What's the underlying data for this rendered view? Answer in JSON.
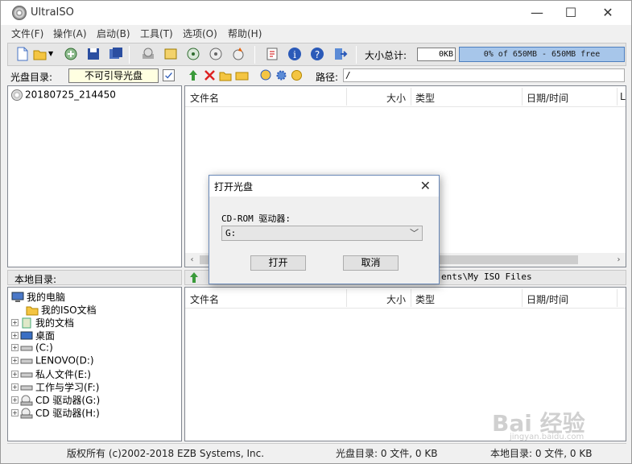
{
  "window": {
    "title": "UltraISO",
    "minimize": "—",
    "maximize": "☐",
    "close": "✕"
  },
  "menu": [
    "文件(F)",
    "操作(A)",
    "启动(B)",
    "工具(T)",
    "选项(O)",
    "帮助(H)"
  ],
  "toolbar": {
    "size_label": "大小总计:",
    "size_value": "0KB",
    "capacity_text": "0% of 650MB - 650MB free",
    "capacity_color": "#a7c6ea"
  },
  "iso_panel": {
    "label": "光盘目录:",
    "boot_status": "不可引导光盘",
    "path_label": "路径:",
    "path_value": "/",
    "tree_item": "20180725_214450",
    "columns": [
      "文件名",
      "大小",
      "类型",
      "日期/时间",
      "L"
    ]
  },
  "local_panel": {
    "label": "本地目录:",
    "path_value": "ents\\My ISO Files",
    "columns": [
      "文件名",
      "大小",
      "类型",
      "日期/时间"
    ],
    "tree": [
      {
        "label": "我的电脑",
        "expander": "",
        "icon": "computer-icon"
      },
      {
        "label": "我的ISO文档",
        "expander": "",
        "icon": "folder-icon"
      },
      {
        "label": "我的文档",
        "expander": "+",
        "icon": "documents-icon"
      },
      {
        "label": "桌面",
        "expander": "+",
        "icon": "desktop-icon"
      },
      {
        "label": "(C:)",
        "expander": "+",
        "icon": "drive-icon"
      },
      {
        "label": "LENOVO(D:)",
        "expander": "+",
        "icon": "drive-icon"
      },
      {
        "label": "私人文件(E:)",
        "expander": "+",
        "icon": "drive-icon"
      },
      {
        "label": "工作与学习(F:)",
        "expander": "+",
        "icon": "drive-icon"
      },
      {
        "label": "CD 驱动器(G:)",
        "expander": "+",
        "icon": "cd-drive-icon"
      },
      {
        "label": "CD 驱动器(H:)",
        "expander": "+",
        "icon": "cd-drive-icon"
      }
    ]
  },
  "status": {
    "copyright": "版权所有 (c)2002-2018 EZB Systems, Inc.",
    "iso_info": "光盘目录: 0 文件, 0 KB",
    "local_info": "本地目录: 0 文件, 0 KB"
  },
  "dialog": {
    "title": "打开光盘",
    "close": "✕",
    "drive_label": "CD-ROM 驱动器:",
    "drive_value": "G:",
    "open_button": "打开",
    "cancel_button": "取消"
  },
  "watermark": {
    "text": "Bai 经验",
    "sub": "jingyan.baidu.com"
  }
}
